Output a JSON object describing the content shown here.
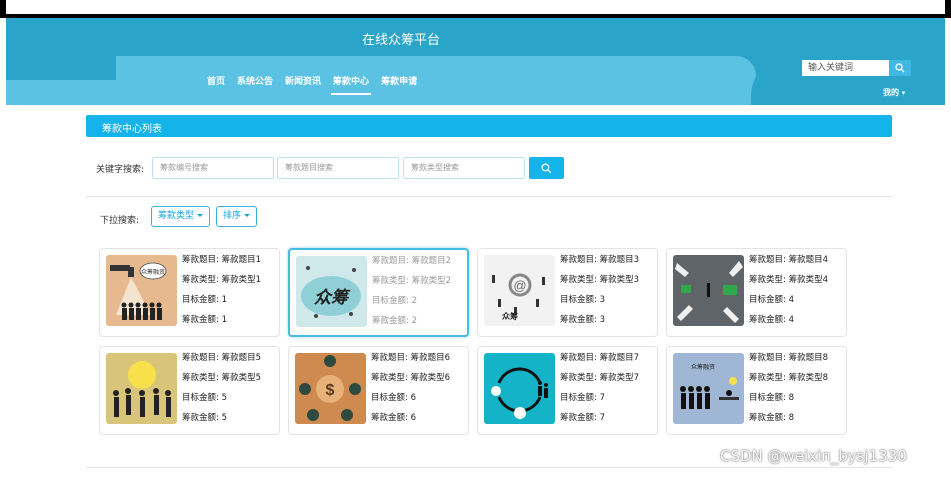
{
  "header": {
    "title": "在线众筹平台",
    "nav": [
      "首页",
      "系统公告",
      "新闻资讯",
      "筹款中心",
      "筹款申请"
    ],
    "active_nav": "筹款中心",
    "search_placeholder": "输入关键词",
    "user_menu": "我的"
  },
  "section": {
    "title": "筹款中心列表"
  },
  "keyword_search": {
    "label": "关键字搜索:",
    "inputs": [
      "筹款编号搜索",
      "筹款题目搜索",
      "筹款类型搜索"
    ]
  },
  "dropdown_search": {
    "label": "下拉搜索:",
    "buttons": [
      "筹款类型",
      "排序"
    ]
  },
  "cards": [
    {
      "title_label": "筹款题目:",
      "title": "筹款题目1",
      "type_label": "筹款类型:",
      "type": "筹款类型1",
      "target_label": "目标金额:",
      "target": "1",
      "amount_label": "筹款金额:",
      "amount": "1"
    },
    {
      "title_label": "筹款题目:",
      "title": "筹款题目2",
      "type_label": "筹款类型:",
      "type": "筹款类型2",
      "target_label": "目标金额:",
      "target": "2",
      "amount_label": "筹款金额:",
      "amount": "2"
    },
    {
      "title_label": "筹款题目:",
      "title": "筹款题目3",
      "type_label": "筹款类型:",
      "type": "筹款类型3",
      "target_label": "目标金额:",
      "target": "3",
      "amount_label": "筹款金额:",
      "amount": "3"
    },
    {
      "title_label": "筹款题目:",
      "title": "筹款题目4",
      "type_label": "筹款类型:",
      "type": "筹款类型4",
      "target_label": "目标金额:",
      "target": "4",
      "amount_label": "筹款金额:",
      "amount": "4"
    },
    {
      "title_label": "筹款题目:",
      "title": "筹款题目5",
      "type_label": "筹款类型:",
      "type": "筹款类型5",
      "target_label": "目标金额:",
      "target": "5",
      "amount_label": "筹款金额:",
      "amount": "5"
    },
    {
      "title_label": "筹款题目:",
      "title": "筹款题目6",
      "type_label": "筹款类型:",
      "type": "筹款类型6",
      "target_label": "目标金额:",
      "target": "6",
      "amount_label": "筹款金额:",
      "amount": "6"
    },
    {
      "title_label": "筹款题目:",
      "title": "筹款题目7",
      "type_label": "筹款类型:",
      "type": "筹款类型7",
      "target_label": "目标金额:",
      "target": "7",
      "amount_label": "筹款金额:",
      "amount": "7"
    },
    {
      "title_label": "筹款题目:",
      "title": "筹款题目8",
      "type_label": "筹款类型:",
      "type": "筹款类型8",
      "target_label": "目标金额:",
      "target": "8",
      "amount_label": "筹款金额:",
      "amount": "8"
    }
  ],
  "thumb_texts": {
    "card1": "众筹融资",
    "card2": "众筹",
    "card3": "众筹",
    "card8": "众筹融资"
  },
  "watermark": "CSDN @weixin_bysj1330",
  "colors": {
    "header": "#2aa5c9",
    "header_light": "#5cc2e3",
    "accent": "#14b4ea"
  }
}
